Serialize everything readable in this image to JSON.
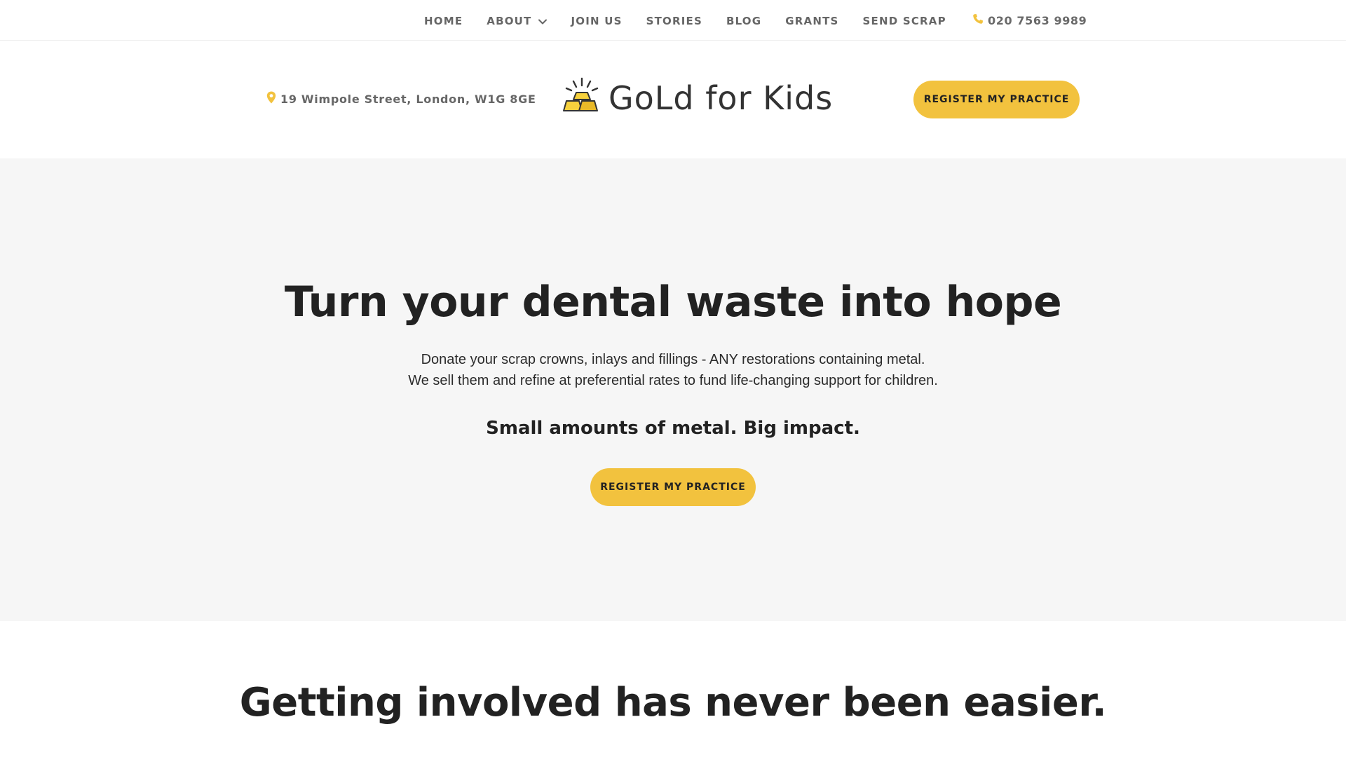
{
  "nav": {
    "items": [
      {
        "label": "HOME"
      },
      {
        "label": "ABOUT",
        "has_dropdown": true
      },
      {
        "label": "JOIN US"
      },
      {
        "label": "STORIES"
      },
      {
        "label": "BLOG"
      },
      {
        "label": "GRANTS"
      },
      {
        "label": "SEND SCRAP"
      }
    ],
    "phone": "020 7563 9989"
  },
  "header": {
    "address": "19 Wimpole Street, London, W1G 8GE",
    "logo_text": "GoLd for Kids",
    "register_button": "REGISTER MY PRACTICE"
  },
  "hero": {
    "title": "Turn your dental waste into hope",
    "line1": "Donate your scrap crowns, inlays and fillings - ANY restorations containing metal.",
    "line2": "We sell them and refine at preferential rates to fund life-changing support for children.",
    "tagline": "Small amounts of metal. Big impact.",
    "register_button": "REGISTER MY PRACTICE"
  },
  "section2": {
    "title": "Getting involved has never been easier."
  },
  "colors": {
    "accent": "#f2c23e",
    "hero_bg": "#f6f6f6",
    "nav_text": "#666666",
    "dark_text": "#222222"
  },
  "icons": {
    "phone": "phone-icon",
    "location": "map-pin-icon",
    "dropdown": "chevron-down-icon",
    "logo": "gold-bars-icon"
  }
}
